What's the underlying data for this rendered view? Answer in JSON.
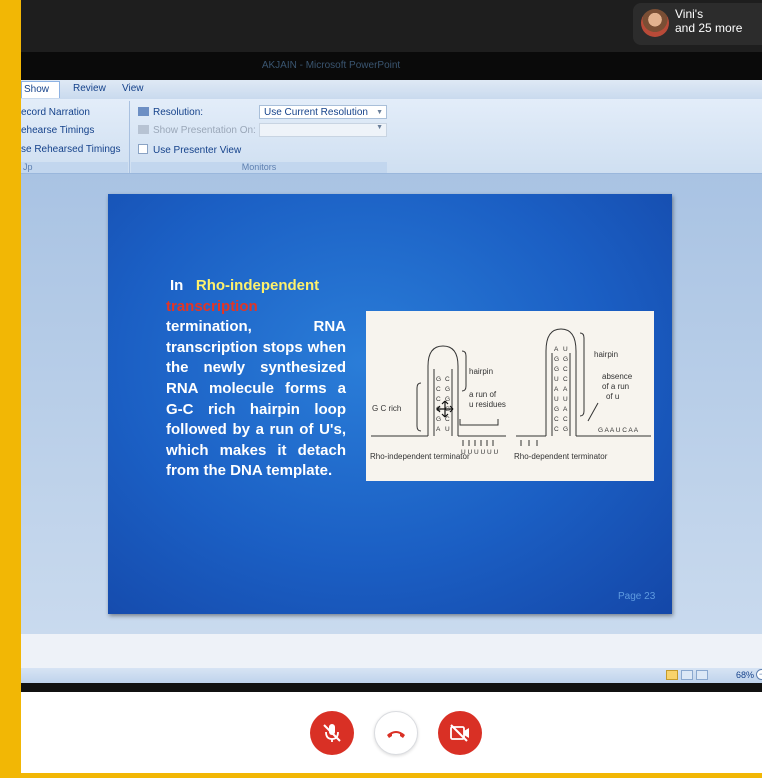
{
  "meeting": {
    "participants_line1": "Vini's",
    "participants_line2": "and 25 more"
  },
  "window": {
    "title": "AKJAIN - Microsoft PowerPoint"
  },
  "ribbon": {
    "tabs": [
      "Show",
      "Review",
      "View"
    ],
    "active_tab": "Show",
    "setup_buttons": [
      "ecord Narration",
      "ehearse Timings",
      "se Rehearsed Timings"
    ],
    "setup_group_label": "Jp",
    "resolution_label": "Resolution:",
    "resolution_value": "Use Current Resolution",
    "show_on_label": "Show Presentation On:",
    "presenter_view_label": "Use Presenter View",
    "monitors_group_label": "Monitors"
  },
  "slide": {
    "text_in": "In",
    "text_highlight_yellow": "Rho-independent",
    "text_highlight_red": "transcription",
    "text_body": "termination, RNA transcription stops when the newly synthesized RNA molecule forms a G-C rich hairpin loop followed by a run of U's, which makes it detach from the DNA template.",
    "page_number": "Page 23",
    "diagram": {
      "left_hairpin": "hairpin",
      "left_run": "a run of",
      "left_run2": "u residues",
      "gc_rich": "G C rich",
      "left_caption": "Rho-independent  terminator",
      "right_hairpin": "hairpin",
      "absence1": "absence",
      "absence2": "of a run",
      "absence3": "of u",
      "right_caption": "Rho-dependent terminator",
      "left_tail": "U U U U U U",
      "right_tail": "G A A U C A A"
    }
  },
  "statusbar": {
    "zoom": "68%"
  },
  "colors": {
    "mute": "#d93025",
    "frame": "#f2b705",
    "slide_blue": "#1b5fc4"
  },
  "call_controls": [
    {
      "icon": "mic-off-icon",
      "label": ""
    },
    {
      "icon": "end-call-icon",
      "label": ""
    },
    {
      "icon": "camera-off-icon",
      "label": ""
    }
  ]
}
